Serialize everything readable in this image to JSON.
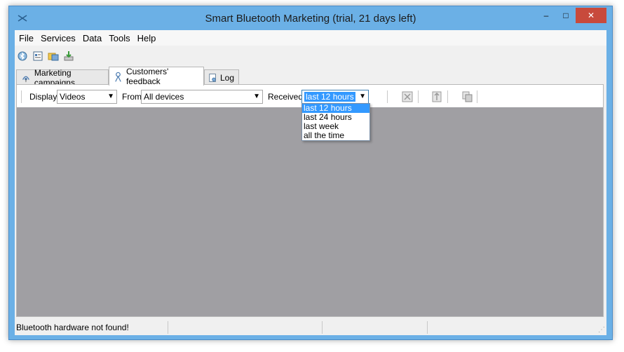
{
  "window": {
    "title": "Smart Bluetooth Marketing (trial, 21 days left)",
    "controls": {
      "minimize": "–",
      "maximize": "□",
      "close": "✕"
    }
  },
  "menu": [
    "File",
    "Services",
    "Data",
    "Tools",
    "Help"
  ],
  "toolbar_icons": [
    "bluetooth-scan-icon",
    "settings-panel-icon",
    "folder-open-icon",
    "download-icon"
  ],
  "tabs": [
    {
      "label": "Marketing campaigns",
      "icon": "antenna-icon",
      "active": false
    },
    {
      "label": "Customers' feedback",
      "icon": "signal-tower-icon",
      "active": true
    },
    {
      "label": "Log",
      "icon": "log-file-icon",
      "active": false
    }
  ],
  "filters": {
    "display_label": "Display",
    "display_value": "Videos",
    "from_label": "From",
    "from_value": "All devices",
    "received_label": "Received",
    "received_value": "last 12 hours",
    "received_options": [
      "last 12 hours",
      "last 24 hours",
      "last week",
      "all the time"
    ]
  },
  "status": {
    "message": "Bluetooth hardware not found!"
  },
  "colors": {
    "titlebar": "#6bb0e6",
    "close_button": "#c84a3c",
    "content_area": "#a09fa3",
    "selection": "#3399ff"
  }
}
